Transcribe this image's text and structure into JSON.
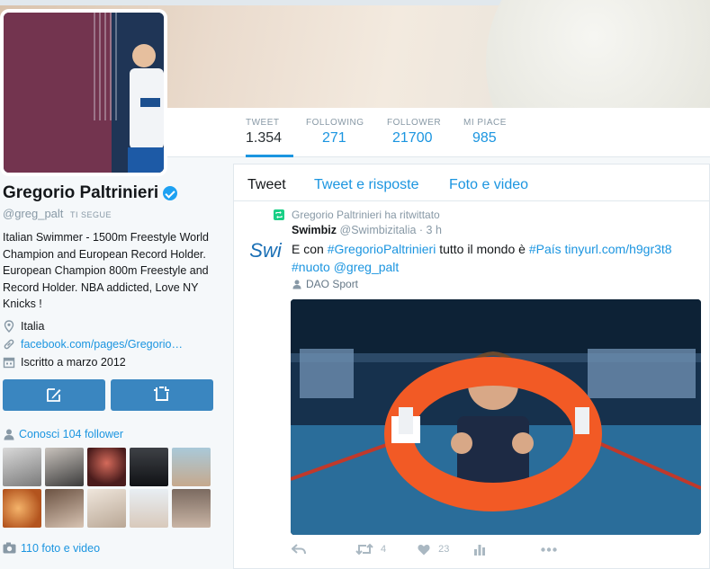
{
  "profile": {
    "name": "Gregorio Paltrinieri",
    "handle": "@greg_palt",
    "follows_you": "TI SEGUE",
    "bio": "Italian Swimmer - 1500m Freestyle World Champion and European Record Holder. European Champion 800m Freestyle and Record Holder. NBA addicted, Love NY Knicks !",
    "location": "Italia",
    "website": "facebook.com/pages/Gregorio…",
    "joined": "Iscritto a marzo 2012",
    "followers_you_know": "Conosci 104 follower",
    "photos_videos": "110 foto e video"
  },
  "stats": [
    {
      "label": "TWEET",
      "value": "1.354"
    },
    {
      "label": "FOLLOWING",
      "value": "271"
    },
    {
      "label": "FOLLOWER",
      "value": "21700"
    },
    {
      "label": "MI PIACE",
      "value": "985"
    }
  ],
  "tabs": [
    "Tweet",
    "Tweet e risposte",
    "Foto e video"
  ],
  "tweet": {
    "retweeted_by": "Gregorio Paltrinieri ha ritwittato",
    "author_name": "Swimbiz",
    "author_handle": "@Swimbizitalia",
    "time": "· 3 h",
    "avatar_text": "Swi",
    "text_part1": "E con ",
    "hashtag1": "#GregorioPaltrinieri",
    "text_part2": " tutto il mondo è ",
    "hashtag2": "#País",
    "link": " tinyurl.com/h9gr3t8",
    "hashtag3": "#nuoto",
    "mention": " @greg_palt",
    "location_tag": "DAO Sport",
    "retweet_count": "4",
    "like_count": "23"
  },
  "colors": {
    "accent": "#1b95e0",
    "button": "#3a86c0",
    "retweet_green": "#19cf86"
  }
}
